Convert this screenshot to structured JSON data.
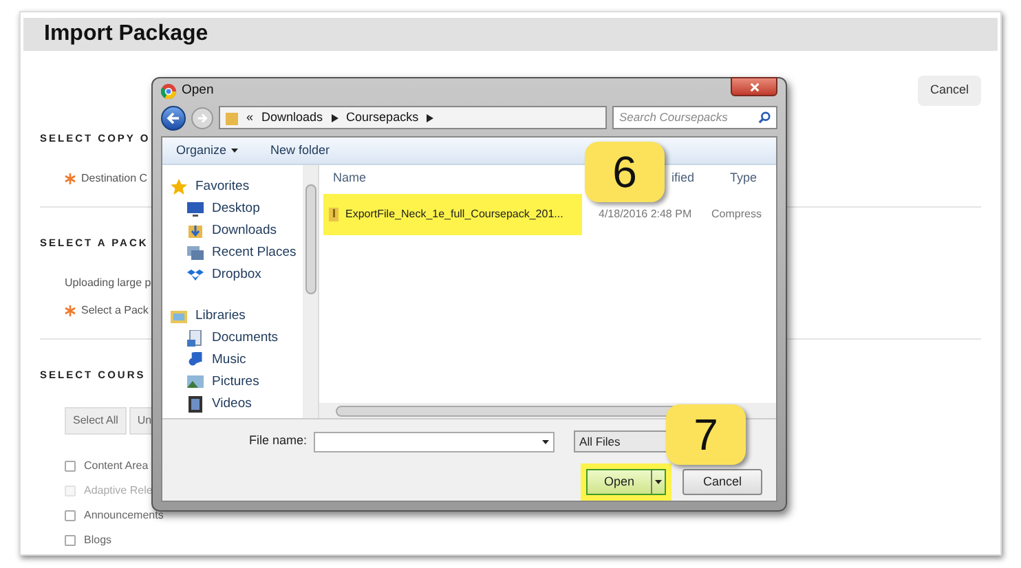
{
  "page": {
    "title": "Import Package",
    "cancel_button": "Cancel",
    "sections": [
      {
        "heading": "SELECT COPY O",
        "fields": [
          {
            "kind": "required",
            "text": "Destination C"
          }
        ]
      },
      {
        "heading": "SELECT A PACK",
        "fields": [
          {
            "kind": "note",
            "text": "Uploading large p"
          },
          {
            "kind": "required",
            "text": "Select a Pack"
          }
        ]
      },
      {
        "heading": "SELECT COURS",
        "buttons": [
          "Select All",
          "Un"
        ],
        "checkboxes": [
          {
            "label": "Content Area",
            "checked": false,
            "disabled": false
          },
          {
            "label": "Adaptive Rele",
            "checked": false,
            "disabled": true
          },
          {
            "label": "Announcements",
            "checked": false,
            "disabled": false
          },
          {
            "label": "Blogs",
            "checked": false,
            "disabled": false
          }
        ]
      }
    ]
  },
  "dialog": {
    "title": "Open",
    "breadcrumb": [
      "«",
      "Downloads",
      "Coursepacks"
    ],
    "search": {
      "placeholder": "Search Coursepacks"
    },
    "toolbar": [
      "Organize",
      "New folder"
    ],
    "nav": [
      {
        "label": "Favorites",
        "kind": "star",
        "children": [
          {
            "label": "Desktop",
            "kind": "desktop"
          },
          {
            "label": "Downloads",
            "kind": "downloads"
          },
          {
            "label": "Recent Places",
            "kind": "recent"
          },
          {
            "label": "Dropbox",
            "kind": "dropbox"
          }
        ]
      },
      {
        "label": "Libraries",
        "kind": "libraries",
        "children": [
          {
            "label": "Documents",
            "kind": "documents"
          },
          {
            "label": "Music",
            "kind": "music"
          },
          {
            "label": "Pictures",
            "kind": "pictures"
          },
          {
            "label": "Videos",
            "kind": "videos"
          }
        ]
      }
    ],
    "columns": [
      "Name",
      "ified",
      "Type"
    ],
    "files": [
      {
        "name": "ExportFile_Neck_1e_full_Coursepack_201...",
        "modified": "4/18/2016 2:48 PM",
        "type": "Compress",
        "highlighted": true
      }
    ],
    "file_name_label": "File name:",
    "file_type": "All Files",
    "open_button": {
      "label": "Open",
      "highlighted": true
    },
    "cancel_button": "Cancel"
  },
  "callouts": [
    "6",
    "7"
  ]
}
